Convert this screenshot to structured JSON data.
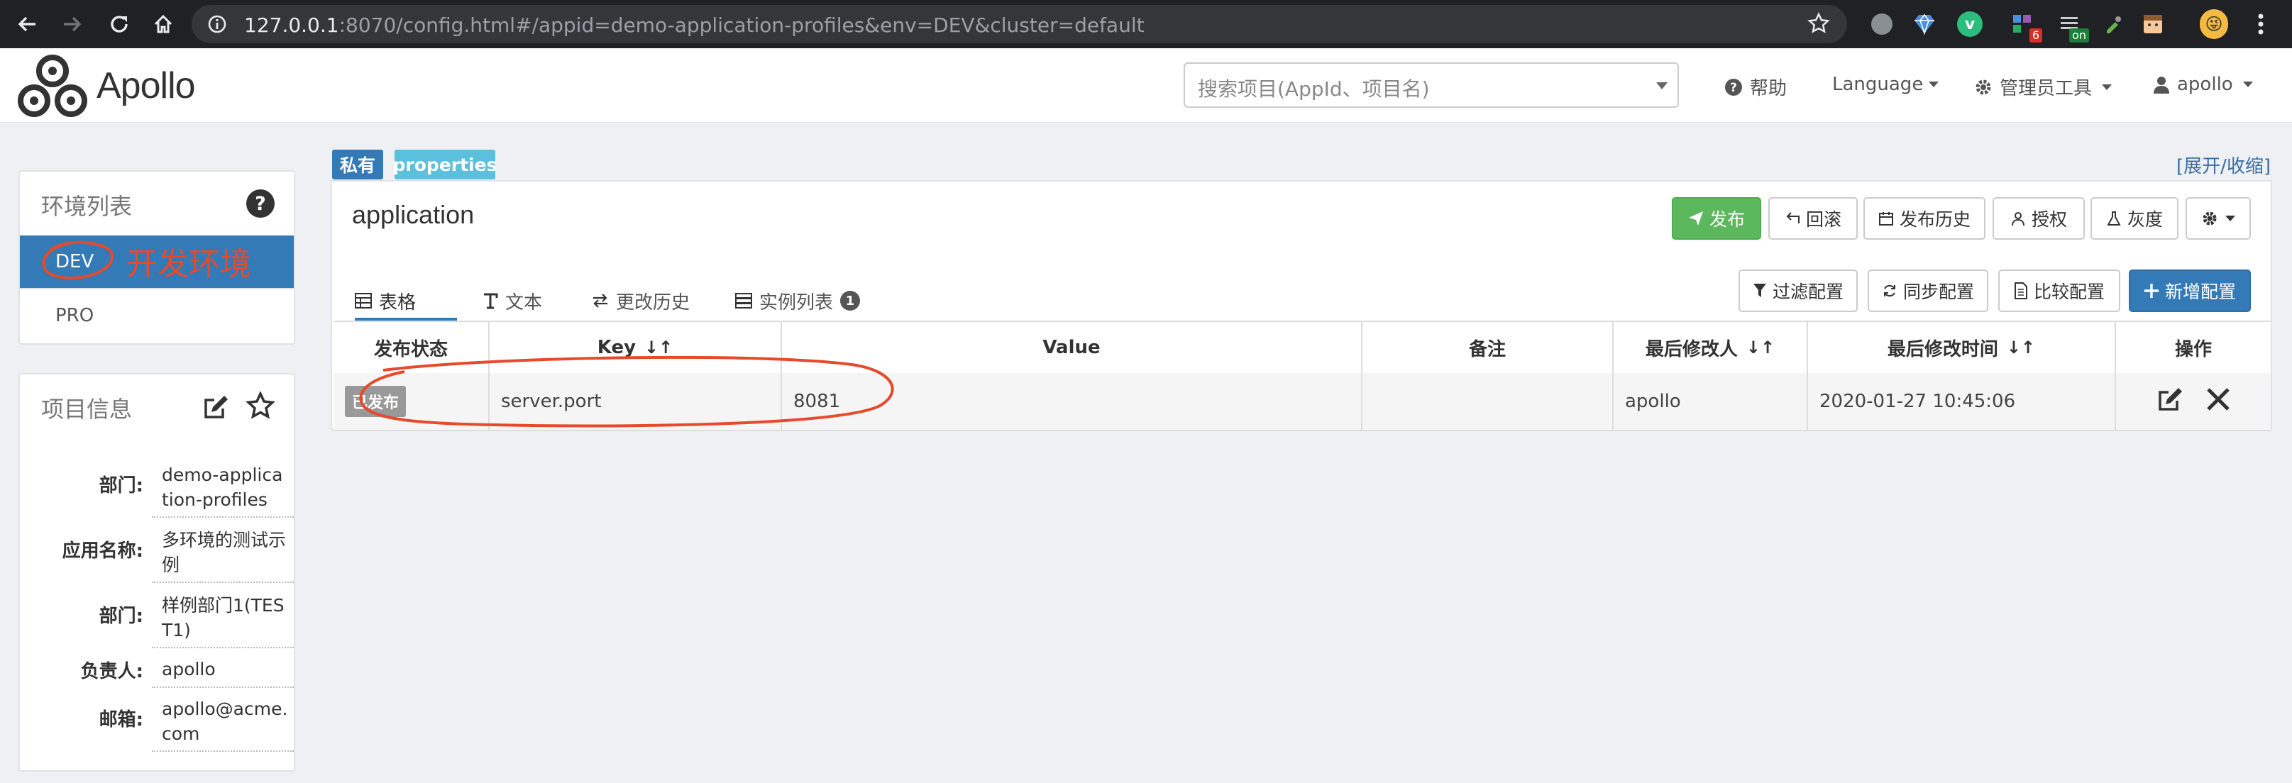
{
  "browser": {
    "url_host": "127.0.0.1",
    "url_rest": ":8070/config.html#/appid=demo-application-profiles&env=DEV&cluster=default",
    "extension_badges": [
      "6",
      "on"
    ]
  },
  "navbar": {
    "brand": "Apollo",
    "search_placeholder": "搜索项目(AppId、项目名)",
    "help": "帮助",
    "language": "Language",
    "admin_tools": "管理员工具",
    "user": "apollo"
  },
  "env_panel": {
    "title": "环境列表",
    "envs": [
      {
        "label": "DEV",
        "active": true
      },
      {
        "label": "PRO",
        "active": false
      }
    ],
    "annotation": "开发环境"
  },
  "project_panel": {
    "title": "项目信息",
    "rows": [
      {
        "key": "部门:",
        "value": "demo-application-profiles"
      },
      {
        "key": "应用名称:",
        "value": "多环境的测试示例"
      },
      {
        "key": "部门:",
        "value": "样例部门1(TEST1)"
      },
      {
        "key": "负责人:",
        "value": "apollo"
      },
      {
        "key": "邮箱:",
        "value": "apollo@acme.com"
      }
    ]
  },
  "namespace": {
    "tags": [
      "私有",
      "properties"
    ],
    "toggle": "[展开/收缩]",
    "name": "application",
    "actions": [
      "发布",
      "回滚",
      "发布历史",
      "授权",
      "灰度"
    ],
    "tabs": [
      {
        "label": "表格"
      },
      {
        "label": "文本"
      },
      {
        "label": "更改历史"
      },
      {
        "label": "实例列表",
        "badge": "1"
      }
    ],
    "tools": [
      "过滤配置",
      "同步配置",
      "比较配置",
      "新增配置"
    ],
    "table": {
      "headers": [
        "发布状态",
        "Key",
        "Value",
        "备注",
        "最后修改人",
        "最后修改时间",
        "操作"
      ],
      "rows": [
        {
          "status": "已发布",
          "key": "server.port",
          "value": "8081",
          "comment": "",
          "modifier": "apollo",
          "time": "2020-01-27 10:45:06"
        }
      ]
    }
  },
  "colors": {
    "primary": "#337ab7",
    "success": "#5cb85c",
    "annotation": "#e8492b",
    "tag_private": "#337ab7",
    "tag_properties": "#5bc0de"
  }
}
